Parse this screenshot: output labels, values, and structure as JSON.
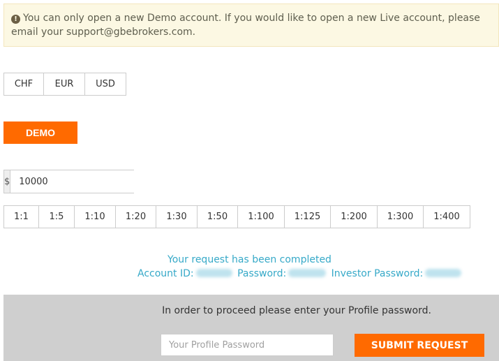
{
  "notice": {
    "icon": "exclamation-circle-icon",
    "text": "You can only open a new Demo account. If you would like to open a new Live account, please email your support@gbebrokers.com."
  },
  "currency": {
    "options": [
      "CHF",
      "EUR",
      "USD"
    ]
  },
  "account_type": {
    "label": "DEMO"
  },
  "amount": {
    "currency_symbol": "$",
    "value": "10000"
  },
  "leverage": {
    "options": [
      "1:1",
      "1:5",
      "1:10",
      "1:20",
      "1:30",
      "1:50",
      "1:100",
      "1:125",
      "1:200",
      "1:300",
      "1:400"
    ]
  },
  "result": {
    "title": "Your request has been completed",
    "account_id_label": "Account ID:",
    "password_label": "Password:",
    "investor_password_label": "Investor Password:"
  },
  "profile": {
    "prompt": "In order to proceed please enter your Profile password.",
    "password_placeholder": "Your Profile Password",
    "submit_label": "SUBMIT REQUEST"
  },
  "colors": {
    "accent": "#ff6a00",
    "notice_bg": "#fcf8e3",
    "result_text": "#36a9c8",
    "panel_bg": "#cfcfcf"
  }
}
